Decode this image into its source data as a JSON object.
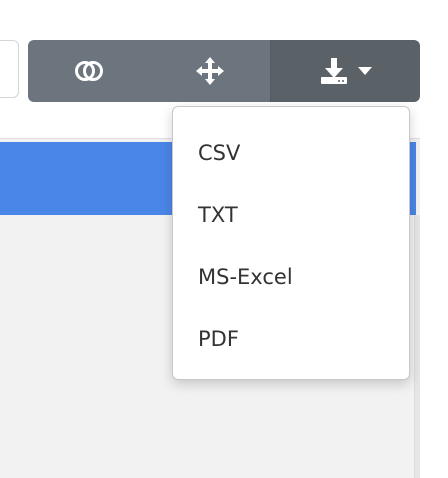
{
  "toolbar": {
    "buttons": [
      {
        "name": "toggle-columns",
        "icon": "toggle-icon"
      },
      {
        "name": "move",
        "icon": "move-arrows-icon"
      },
      {
        "name": "export",
        "icon": "download-icon",
        "has_dropdown": true
      }
    ],
    "colors": {
      "button_bg": "#6c757d",
      "button_active_bg": "#5a6268",
      "icon": "#ffffff"
    }
  },
  "export_menu": {
    "items": [
      {
        "label": "CSV"
      },
      {
        "label": "TXT"
      },
      {
        "label": "MS-Excel"
      },
      {
        "label": "PDF"
      }
    ]
  },
  "table": {
    "header_color": "#4a86e8",
    "body_color": "#f2f2f2"
  }
}
